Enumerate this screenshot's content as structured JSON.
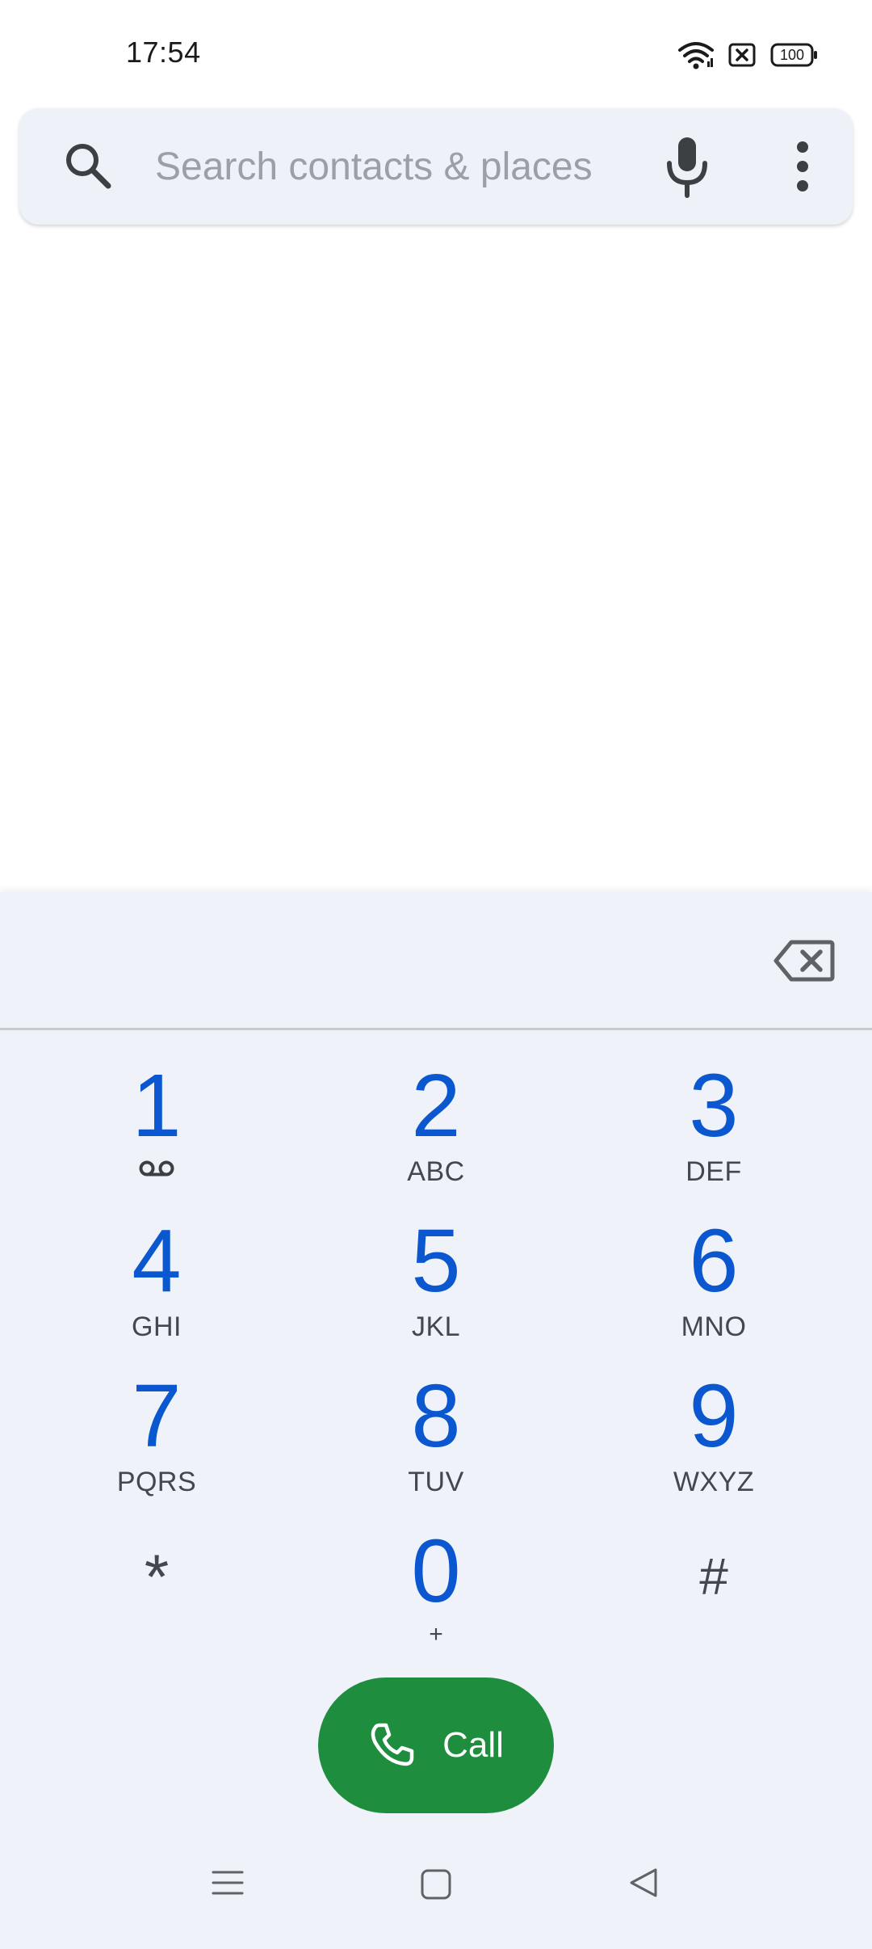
{
  "status_bar": {
    "time": "17:54",
    "battery_level": "100",
    "icons": [
      "wifi-icon",
      "no-sim-icon",
      "battery-icon"
    ]
  },
  "search": {
    "placeholder": "Search contacts & places",
    "value": "",
    "icons": [
      "search-icon",
      "mic-icon",
      "more-vert-icon"
    ]
  },
  "dialpad": {
    "entered_number": "",
    "keys": [
      {
        "digit": "1",
        "letters": "",
        "icon": "voicemail-icon"
      },
      {
        "digit": "2",
        "letters": "ABC"
      },
      {
        "digit": "3",
        "letters": "DEF"
      },
      {
        "digit": "4",
        "letters": "GHI"
      },
      {
        "digit": "5",
        "letters": "JKL"
      },
      {
        "digit": "6",
        "letters": "MNO"
      },
      {
        "digit": "7",
        "letters": "PQRS"
      },
      {
        "digit": "8",
        "letters": "TUV"
      },
      {
        "digit": "9",
        "letters": "WXYZ"
      },
      {
        "digit": "*",
        "letters": ""
      },
      {
        "digit": "0",
        "letters": "+"
      },
      {
        "digit": "#",
        "letters": ""
      }
    ],
    "call_label": "Call"
  },
  "navigation": {
    "buttons": [
      "menu-icon",
      "home-icon",
      "back-icon"
    ]
  },
  "colors": {
    "digit_blue": "#0b57d0",
    "call_green": "#1e8e3e",
    "dialpad_bg": "#eff2f9",
    "search_bg": "#eff1f8"
  }
}
